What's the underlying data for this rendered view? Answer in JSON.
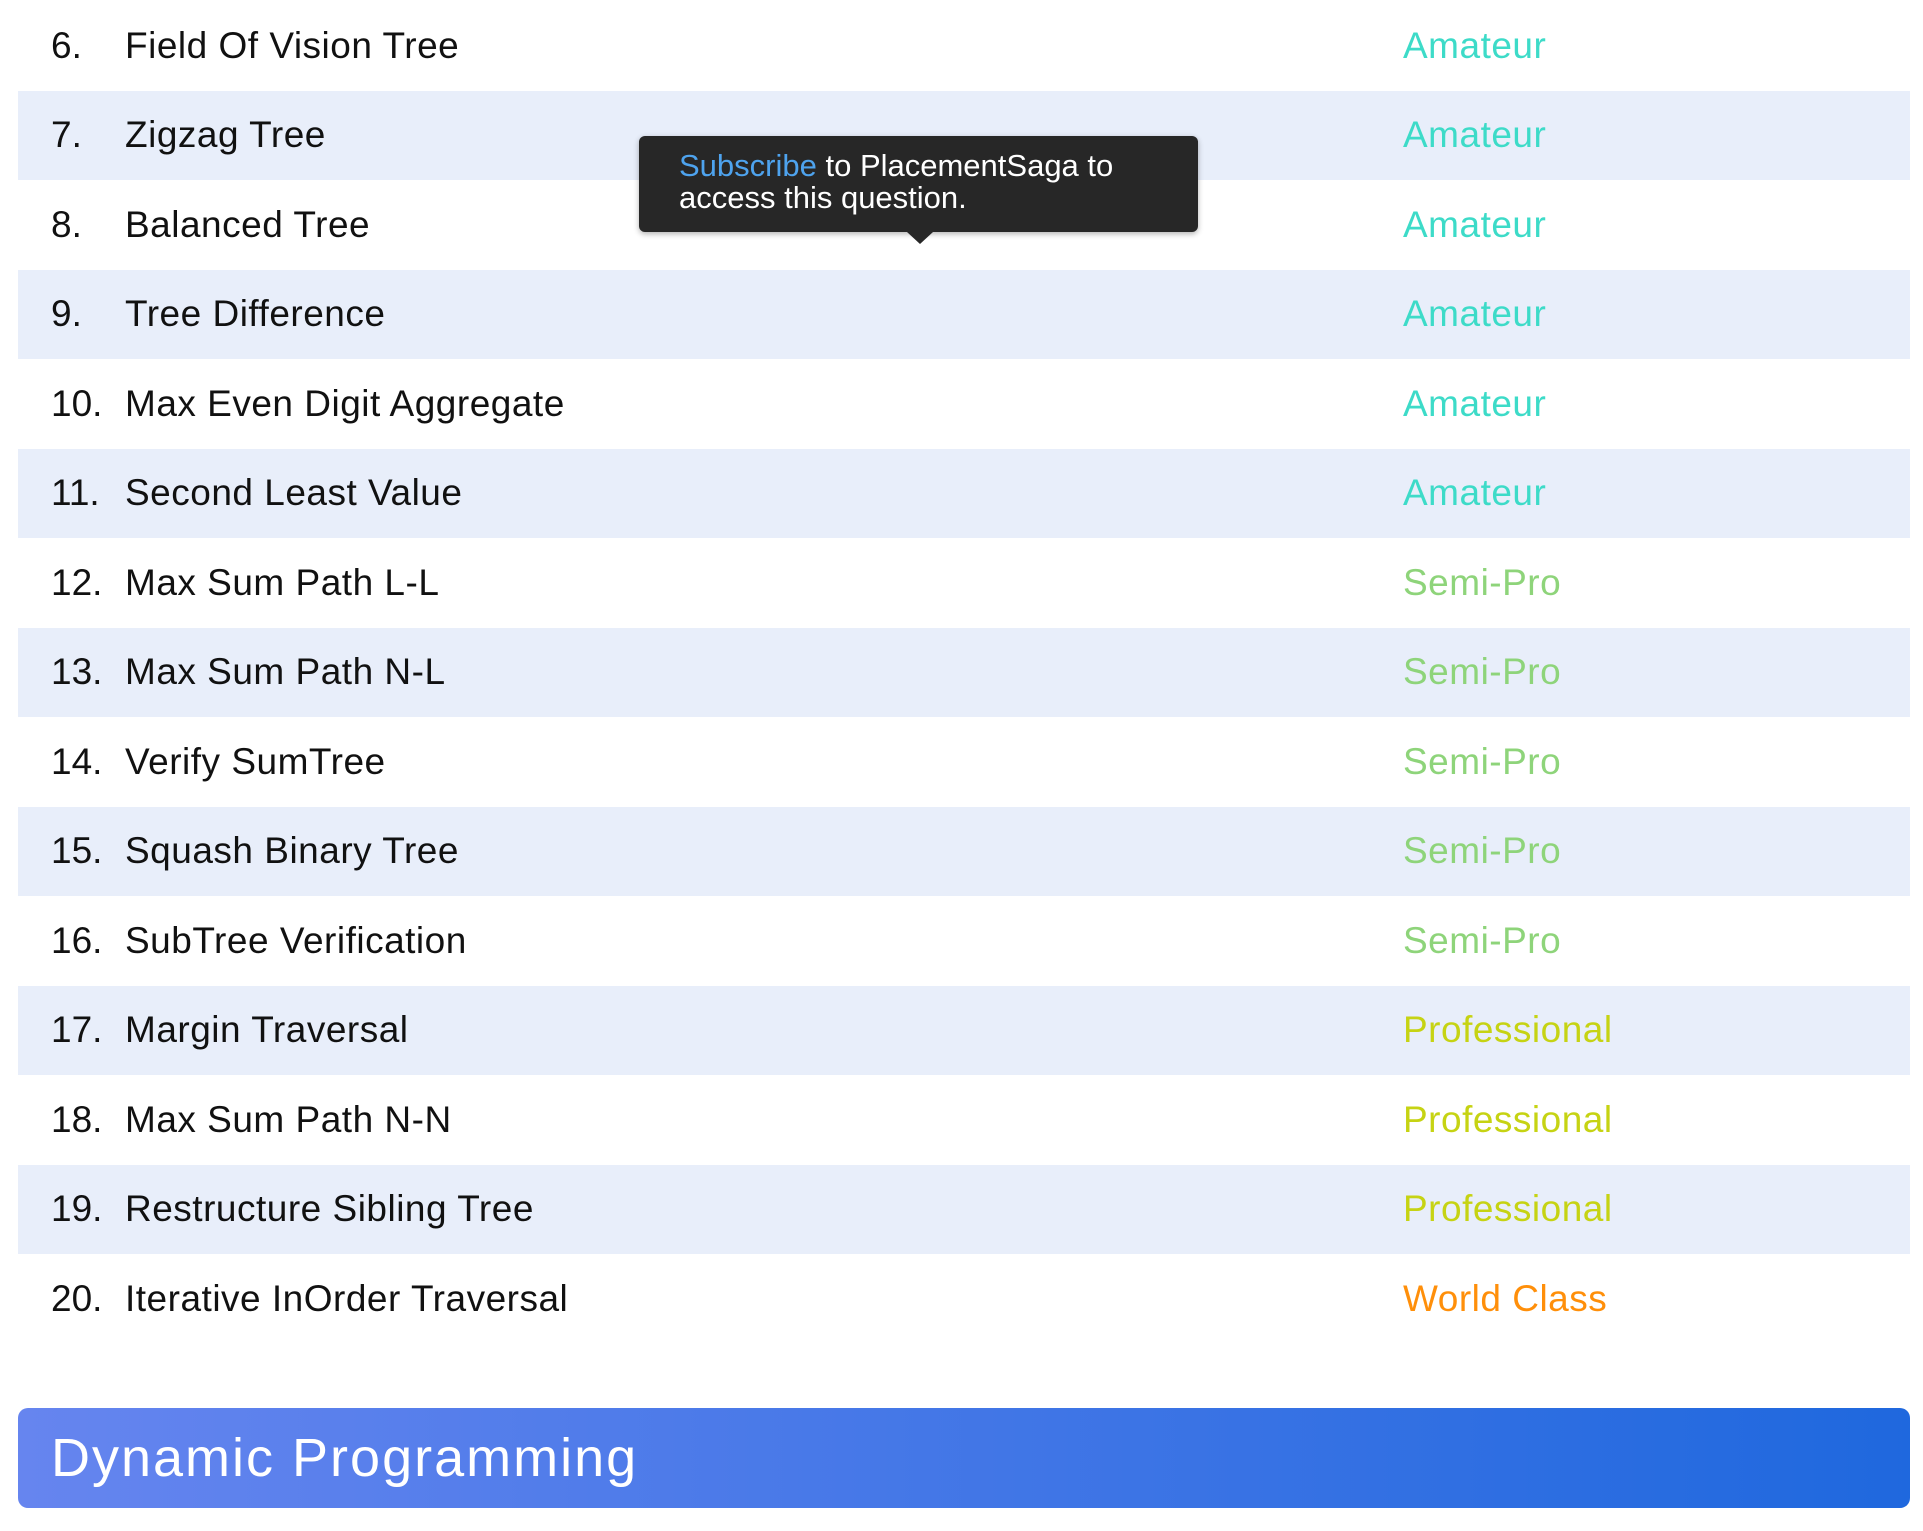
{
  "questions": [
    {
      "num": "6.",
      "title": "Field Of Vision Tree",
      "level": "Amateur"
    },
    {
      "num": "7.",
      "title": "Zigzag Tree",
      "level": "Amateur"
    },
    {
      "num": "8.",
      "title": "Balanced Tree",
      "level": "Amateur"
    },
    {
      "num": "9.",
      "title": "Tree Difference",
      "level": "Amateur"
    },
    {
      "num": "10.",
      "title": "Max Even Digit Aggregate",
      "level": "Amateur"
    },
    {
      "num": "11.",
      "title": "Second Least Value",
      "level": "Amateur"
    },
    {
      "num": "12.",
      "title": "Max Sum Path L-L",
      "level": "Semi-Pro"
    },
    {
      "num": "13.",
      "title": "Max Sum Path N-L",
      "level": "Semi-Pro"
    },
    {
      "num": "14.",
      "title": "Verify SumTree",
      "level": "Semi-Pro"
    },
    {
      "num": "15.",
      "title": "Squash Binary Tree",
      "level": "Semi-Pro"
    },
    {
      "num": "16.",
      "title": "SubTree Verification",
      "level": "Semi-Pro"
    },
    {
      "num": "17.",
      "title": "Margin Traversal",
      "level": "Professional"
    },
    {
      "num": "18.",
      "title": "Max Sum Path N-N",
      "level": "Professional"
    },
    {
      "num": "19.",
      "title": "Restructure Sibling Tree",
      "level": "Professional"
    },
    {
      "num": "20.",
      "title": "Iterative InOrder Traversal",
      "level": "World Class"
    }
  ],
  "level_colors": {
    "Amateur": "#3ddbc8",
    "Semi-Pro": "#8ed47a",
    "Professional": "#c6d313",
    "World Class": "#ff8f0a"
  },
  "tooltip": {
    "link": "Subscribe",
    "text": " to PlacementSaga to access this question."
  },
  "section": {
    "title": "Dynamic Programming"
  }
}
